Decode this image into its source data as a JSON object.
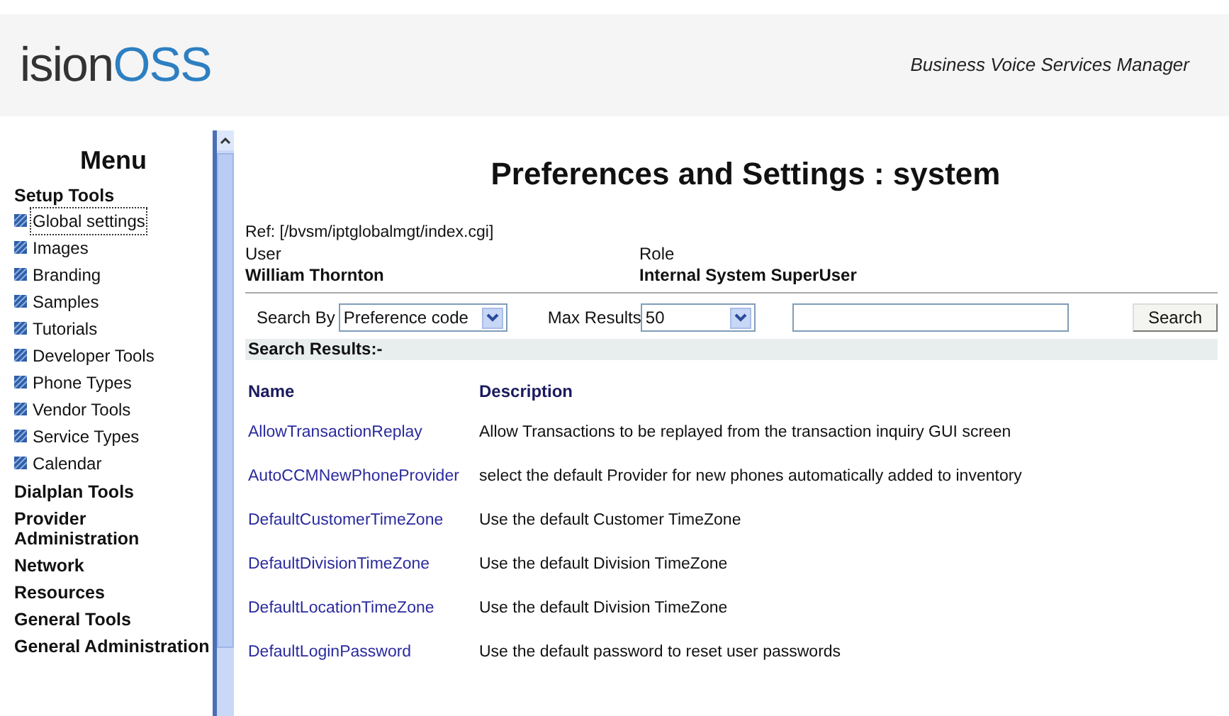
{
  "logo": {
    "dark": "ision",
    "accent": "OSS"
  },
  "app_title": "Business Voice Services Manager",
  "sidebar": {
    "title": "Menu",
    "sections": [
      {
        "label": "Setup Tools",
        "items": [
          {
            "label": "Global settings",
            "selected": true
          },
          {
            "label": "Images",
            "selected": false
          },
          {
            "label": "Branding",
            "selected": false
          },
          {
            "label": "Samples",
            "selected": false
          },
          {
            "label": "Tutorials",
            "selected": false
          },
          {
            "label": "Developer Tools",
            "selected": false
          },
          {
            "label": "Phone Types",
            "selected": false
          },
          {
            "label": "Vendor Tools",
            "selected": false
          },
          {
            "label": "Service Types",
            "selected": false
          },
          {
            "label": "Calendar",
            "selected": false
          }
        ]
      },
      {
        "label": "Dialplan Tools"
      },
      {
        "label": "Provider Administration"
      },
      {
        "label": "Network"
      },
      {
        "label": "Resources"
      },
      {
        "label": "General Tools"
      },
      {
        "label": "General Administration"
      }
    ]
  },
  "page": {
    "title": "Preferences and Settings : system",
    "ref": "Ref: [/bvsm/iptglobalmgt/index.cgi]",
    "user_label": "User",
    "user": "William Thornton",
    "role_label": "Role",
    "role": "Internal System SuperUser"
  },
  "search": {
    "by_label": "Search By",
    "by_value": "Preference code",
    "max_label": "Max Results",
    "max_value": "50",
    "button": "Search"
  },
  "results": {
    "title": "Search Results:-",
    "columns": [
      "Name",
      "Description"
    ],
    "rows": [
      {
        "name": "AllowTransactionReplay",
        "description": "Allow Transactions to be replayed from the transaction inquiry GUI screen"
      },
      {
        "name": "AutoCCMNewPhoneProvider",
        "description": "select the default Provider for new phones automatically added to inventory"
      },
      {
        "name": "DefaultCustomerTimeZone",
        "description": "Use the default Customer TimeZone"
      },
      {
        "name": "DefaultDivisionTimeZone",
        "description": "Use the default Division TimeZone"
      },
      {
        "name": "DefaultLocationTimeZone",
        "description": "Use the default Division TimeZone"
      },
      {
        "name": "DefaultLoginPassword",
        "description": "Use the default password to reset user passwords"
      }
    ]
  }
}
